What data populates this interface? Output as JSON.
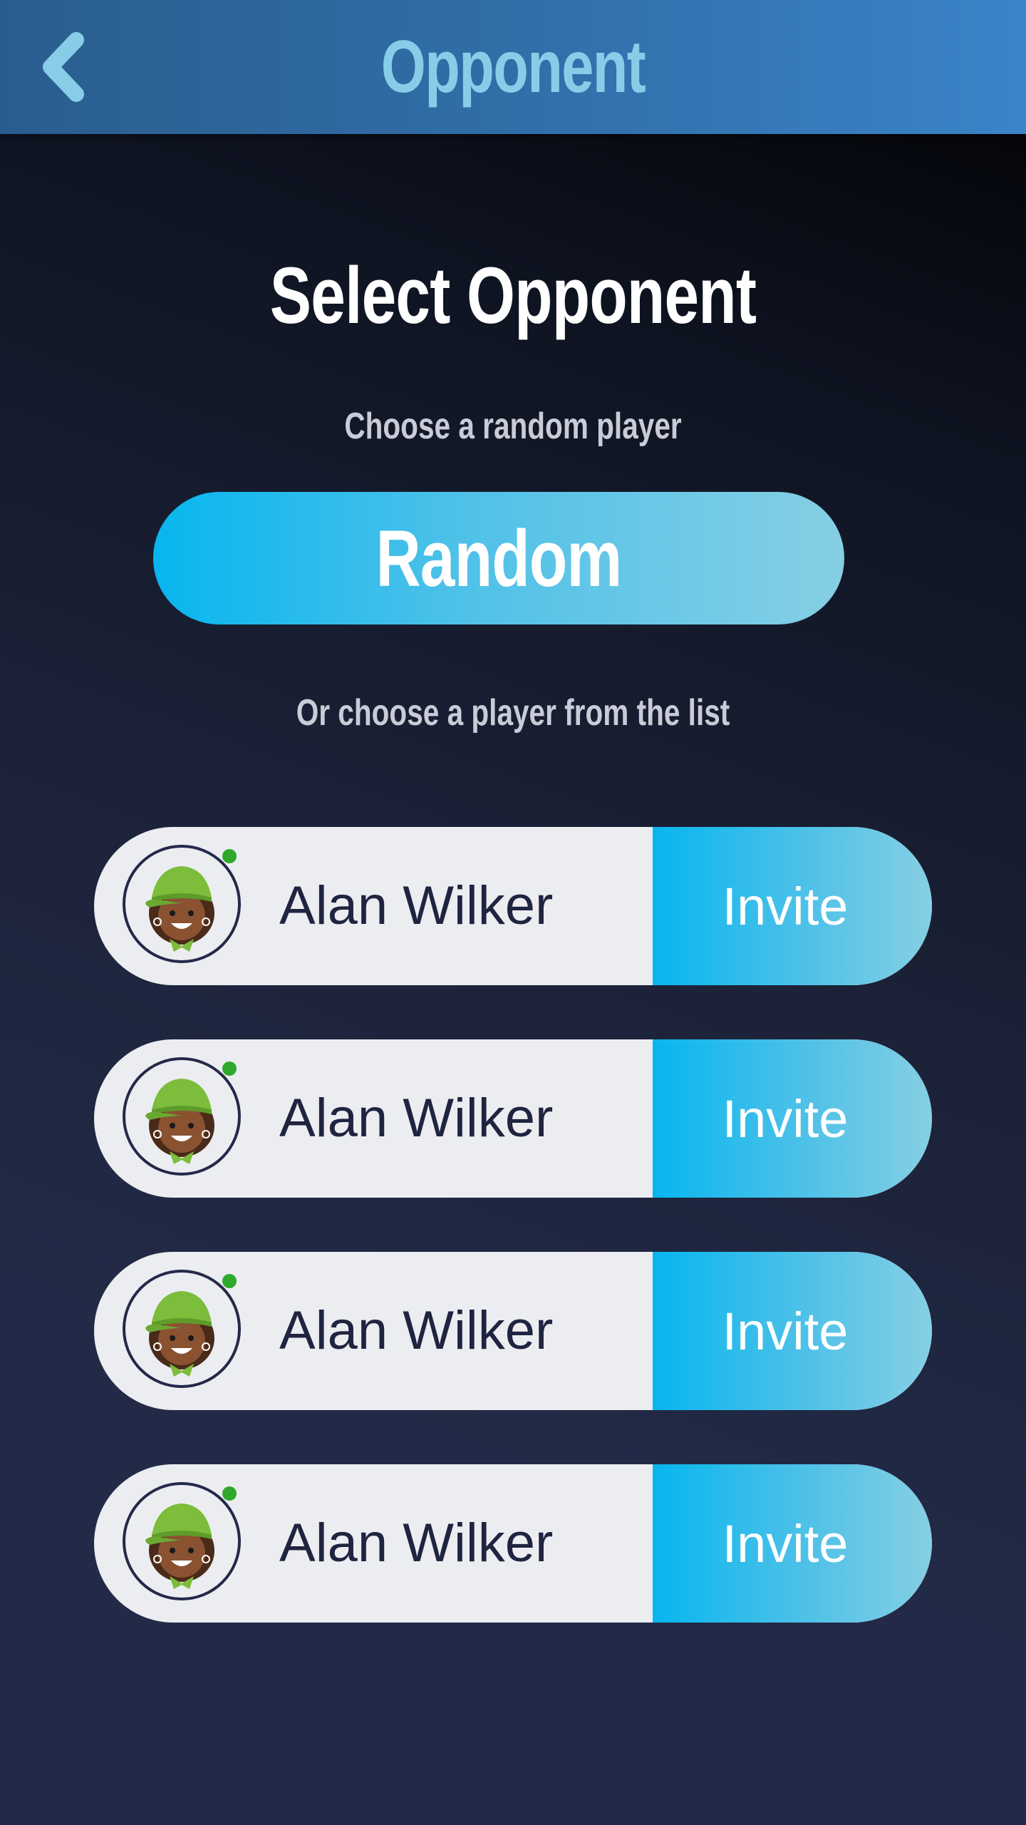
{
  "header": {
    "title": "Opponent",
    "back_icon": "chevron-left-icon",
    "colors": {
      "bar_start": "#2a5d8e",
      "bar_end": "#3a84c8",
      "title": "#87cde8"
    }
  },
  "main": {
    "heading": "Select Opponent",
    "random_prompt": "Choose a random player",
    "random_button_label": "Random",
    "list_prompt": "Or choose a player from the list"
  },
  "players": [
    {
      "name": "Alan Wilker",
      "invite_label": "Invite",
      "status": "online",
      "avatar_icon": "avatar-green-cap-icon"
    },
    {
      "name": "Alan Wilker",
      "invite_label": "Invite",
      "status": "online",
      "avatar_icon": "avatar-green-cap-icon"
    },
    {
      "name": "Alan Wilker",
      "invite_label": "Invite",
      "status": "online",
      "avatar_icon": "avatar-green-cap-icon"
    },
    {
      "name": "Alan Wilker",
      "invite_label": "Invite",
      "status": "online",
      "avatar_icon": "avatar-green-cap-icon"
    }
  ],
  "colors": {
    "accent_start": "#07b6ef",
    "accent_end": "#86cfe4",
    "row_background": "#ecedf1",
    "online": "#2fa82c",
    "text_dark": "#1f2440"
  }
}
